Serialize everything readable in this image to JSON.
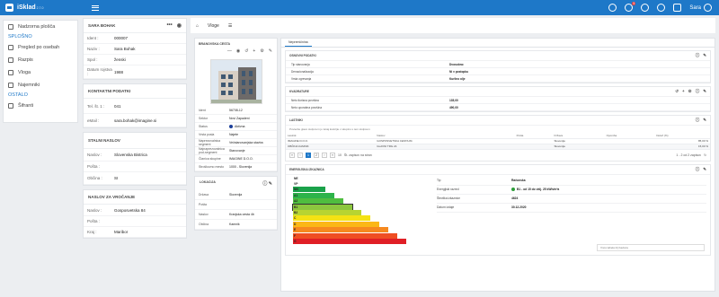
{
  "app": {
    "name": "iSklad",
    "version": "2.7.0",
    "user": "Sara",
    "notif": "5"
  },
  "sidebar": {
    "items": [
      "Nadzorna plošča",
      "Pregled po osebah",
      "Razpis",
      "Vloga",
      "Najemniki",
      "Šifranti"
    ],
    "heads": [
      "SPLOŠNO",
      "OSTALO"
    ]
  },
  "person": {
    "title": "SARA BOHAK",
    "rows": [
      [
        "Ident :",
        "000007"
      ],
      [
        "Naziv :",
        "Sara Bohak"
      ],
      [
        "Spol :",
        "ženski"
      ],
      [
        "Datum rojstva :",
        "1988"
      ]
    ]
  },
  "contact": {
    "title": "KONTAKTNI PODATKI",
    "rows": [
      [
        "Tel. št. 1 :",
        "041"
      ],
      [
        "eMail :",
        "sara.bohak@imagine.si"
      ]
    ]
  },
  "address": {
    "title": "STALNI NASLOV",
    "rows": [
      [
        "Naslov :",
        "Slovenska Bistrica"
      ],
      [
        "Pošta :",
        ""
      ],
      [
        "Občina :",
        "SI"
      ]
    ]
  },
  "delivery": {
    "title": "NASLOV ZA VROČANJE",
    "rows": [
      [
        "Naslov :",
        "Gosposvetska 84"
      ],
      [
        "Pošta :",
        ""
      ],
      [
        "Kraj :",
        "Maribor"
      ]
    ]
  },
  "tabs": {
    "vloge": "Vloge"
  },
  "unit": {
    "title": "BRANOVSKA CESTA",
    "rows": [
      [
        "Ident",
        "56708-12"
      ],
      [
        "Sektor",
        "Novi Zapadeni"
      ],
      [
        "Status",
        "Aktivna"
      ],
      [
        "Vrsta posla",
        "Najete"
      ],
      [
        "Naprezovalnica segment",
        "Večstanovanjska stavba"
      ],
      [
        "Najnaprezovalnica pod-segment",
        "Stanovanje"
      ],
      [
        "Članica skupine",
        "IMAGINE D.O.O."
      ],
      [
        "Stroškovno mesto",
        "1000 - Slovenija"
      ]
    ]
  },
  "location": {
    "title": "LOKACIJA",
    "rows": [
      [
        "Država",
        "Slovenija"
      ],
      [
        "Pošta",
        ""
      ],
      [
        "Naslov",
        "Kranjska cesta 4b"
      ],
      [
        "Občina",
        "Kamnik"
      ]
    ]
  },
  "right": {
    "tab": "Nepremičnina",
    "osnovni": {
      "title": "OSNOVNI PODATKI",
      "rows": [
        [
          "Tip stanovanja",
          "Dvosobno"
        ],
        [
          "Denacionalizacija",
          "Ni v postopku"
        ],
        [
          "Vrsta ogrevanja",
          "Kurilno olje"
        ]
      ]
    },
    "kvadrature": {
      "title": "KVADRATURE",
      "rows": [
        [
          "Neto tlorisna površina",
          "135,00"
        ],
        [
          "Neto uporabna površina",
          "490,00"
        ]
      ]
    },
    "lastniki": {
      "title": "LASTNIKI",
      "note": "Povlecite glavo stolpca in jo tukaj kustrijte v skupino s tem stolpcem",
      "cols": [
        "Lastnik",
        "Naslov",
        "Pošta",
        "Država",
        "Opomba",
        "Delež (%)"
      ],
      "rows": [
        [
          "IMAGINE D.O.O.",
          "GOSPOSVETSKA CESTA 84",
          "",
          "Slovenija",
          "",
          "85,00 %"
        ],
        [
          "OBČINA KAMNIK",
          "GLAVNI TRG 24",
          "",
          "Slovenija",
          "",
          "15,00 %"
        ]
      ],
      "pages": [
        "1",
        "2"
      ],
      "pagesize": "10",
      "perpage": "Št. zapisov na stran",
      "count": "1 - 2 od 2 zapisov"
    },
    "energija": {
      "title": "ENERGIJSKA IZKAZNICA",
      "classes": [
        "NE",
        "VP",
        "NN",
        "A1",
        "A2",
        "B1",
        "B2",
        "C",
        "D",
        "E",
        "F",
        "G"
      ],
      "rows": [
        [
          "Tip",
          "Računska"
        ],
        [
          "Energijski razred",
          "B1 - od 15 do vklj. 25 kWh/m²a"
        ],
        [
          "Številka izkaznice",
          "4624"
        ],
        [
          "Datum izdaje",
          "30.12.2020"
        ]
      ],
      "view": "Vnos tabela trij bavisca"
    }
  },
  "colors": {
    "brand": "#1e78c8"
  }
}
